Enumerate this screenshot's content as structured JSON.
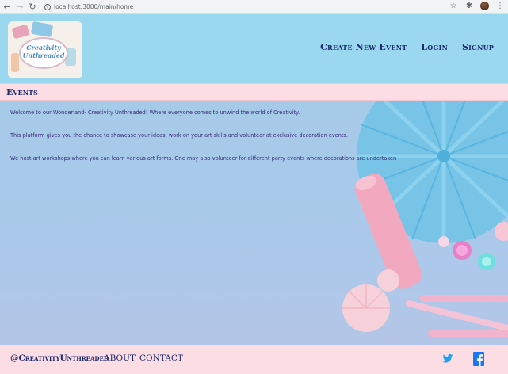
{
  "browser": {
    "url": "localhost:3000/main/home",
    "back_icon": "back-arrow-icon",
    "forward_icon": "forward-arrow-icon",
    "reload_icon": "reload-icon"
  },
  "header": {
    "logo_text_line1": "Creativity",
    "logo_text_line2": "Unthreaded",
    "nav": {
      "create": "Create New Event",
      "login": "Login",
      "signup": "Signup"
    }
  },
  "section": {
    "title": "Events"
  },
  "main": {
    "paragraphs": [
      "Welcome to our Wonderland- Creativity Unthreaded! Where everyone comes to unwind the world of Creativity.",
      "This platform gives you the chance to showcase your ideas, work on your art skills and volunteer at exclusive decoration events.",
      "We host art workshops where you can learn various art forms. One may also volunteer for different party events where decorations are undertaken"
    ]
  },
  "footer": {
    "handle": "@CreativityUnthreaded",
    "about": "ABOUT",
    "contact": "CONTACT"
  },
  "colors": {
    "header_bg": "#9ad8ef",
    "pink_bar": "#fcdde4",
    "nav_text": "#1d2b6b",
    "body_text": "#3a2a78",
    "twitter": "#1da1f2",
    "facebook": "#1877f2"
  }
}
